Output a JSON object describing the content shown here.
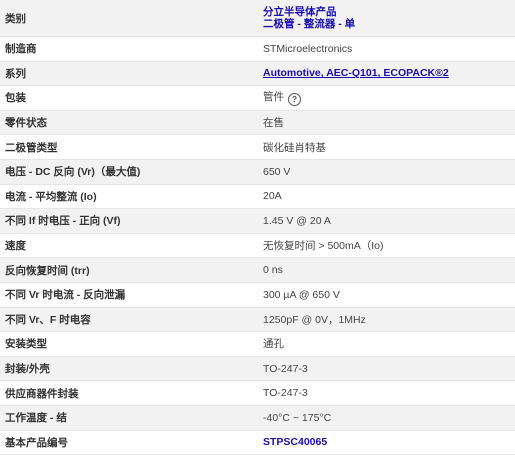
{
  "rows": [
    {
      "label": "类别",
      "values": [
        "分立半导体产品",
        "二极管 - 整流器 - 单"
      ]
    },
    {
      "label": "制造商",
      "value": "STMicroelectronics"
    },
    {
      "label": "系列",
      "value": "Automotive, AEC-Q101, ECOPACK®2"
    },
    {
      "label": "包装",
      "value": "管件",
      "icon": "help-icon"
    },
    {
      "label": "零件状态",
      "value": "在售"
    },
    {
      "label": "二极管类型",
      "value": "碳化硅肖特基"
    },
    {
      "label": "电压 - DC 反向 (Vr)（最大值)",
      "value": "650 V"
    },
    {
      "label": "电流 - 平均整流 (Io)",
      "value": "20A"
    },
    {
      "label": "不同 If 时电压 - 正向 (Vf)",
      "value": "1.45 V @ 20 A"
    },
    {
      "label": "速度",
      "value": "无恢复时间 > 500mA（Io)"
    },
    {
      "label": "反向恢复时间 (trr)",
      "value": "0 ns"
    },
    {
      "label": "不同 Vr 时电流 - 反向泄漏",
      "value": "300 µA @ 650 V"
    },
    {
      "label": "不同 Vr、F 时电容",
      "value": "1250pF @ 0V，1MHz"
    },
    {
      "label": "安装类型",
      "value": "通孔"
    },
    {
      "label": "封装/外壳",
      "value": "TO-247-3"
    },
    {
      "label": "供应商器件封装",
      "value": "TO-247-3"
    },
    {
      "label": "工作温度 - 结",
      "value": "-40°C ~ 175°C"
    },
    {
      "label": "基本产品编号",
      "value": "STPSC40065"
    }
  ],
  "colors": {
    "link": "#1a0dab",
    "row_stripe": "#f2f2f2",
    "row_plain": "#ffffff",
    "label_text": "#333333",
    "value_text": "#444444"
  }
}
